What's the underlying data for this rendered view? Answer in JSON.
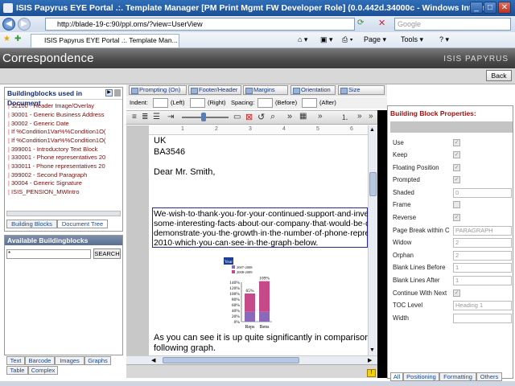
{
  "browser": {
    "title": "ISIS Papyrus EYE Portal .:. Template Manager [PM Print Mgmt FW Developer Role] (0.0.442d.34000c - Windows Interne...",
    "url": "http://blade-19-c:90/ppl.oms/?view=UserView",
    "search_placeholder": "Google",
    "tab_label": "ISIS Papyrus EYE Portal .:. Template Man...",
    "tools": {
      "page": "Page ▾",
      "tools": "Tools ▾"
    }
  },
  "app": {
    "title": "Correspondence",
    "brand": "ISIS PAPYRUS",
    "back_label": "Back"
  },
  "left_panel": {
    "title": "Buildingblocks used in Document",
    "items": [
      "32100 - Header Image/Overlay",
      "30001 - Generic Business Address",
      "30002 - Generic Date",
      "If %Condition1Var%%Condition1O(",
      "If %Condition1Var%%Condition1O(",
      "399001 - Introductory Text Block",
      "330001 - Phone representatives 20",
      "330011 - Phone representatives 20",
      "399002 - Second Paragraph",
      "30004 - Generic Signature",
      "ISIS_PENSION_MWIntro"
    ],
    "tabs": [
      "Building Blocks",
      "Document Tree"
    ]
  },
  "avail_panel": {
    "title": "Available Buildingblocks",
    "search_value": "*",
    "search_button": "SEARCH",
    "tabs_row1": [
      "Text",
      "Barcode",
      "Images",
      "Graphs"
    ],
    "tabs_row2": [
      "Table",
      "Complex"
    ]
  },
  "toolbar": {
    "buttons": [
      "Prompting (On)",
      "Footer/Header",
      "Margins",
      "Orientation",
      "Size"
    ],
    "indent_label": "Indent:",
    "left_label": "(Left)",
    "right_label": "(Right)",
    "spacing_label": "Spacing:",
    "before_label": "(Before)",
    "after_label": "(After)"
  },
  "ruler": {
    "marks": [
      "1",
      "2",
      "3",
      "4",
      "5",
      "6"
    ]
  },
  "document": {
    "lines": [
      "UK",
      "BA3546",
      "Dear Mr. Smith,"
    ],
    "selected_lines": [
      "We·wish·to·thank·you·for·your·continued·support·and·inve",
      "some·interesting·facts·about·our·company·that·would·be·c",
      "demonstrate·you·the·growth·in·the·number·of·phone·repre",
      "2010·which·you·can·see·in·the·graph·below."
    ],
    "after_lines": [
      "As you can see it is up quite significantly in comparison to",
      "following graph."
    ]
  },
  "chart_data": {
    "type": "bar",
    "title": "Year",
    "categories": [
      "Reps",
      "Bens"
    ],
    "series": [
      {
        "name": "2007-2008",
        "values": [
          35,
          35
        ]
      },
      {
        "name": "2008-2009",
        "values": [
          65,
          109
        ]
      }
    ],
    "data_labels": [
      "65%",
      "109%"
    ],
    "y_ticks": [
      "140%",
      "120%",
      "100%",
      "80%",
      "60%",
      "40%",
      "20%",
      "0%"
    ],
    "ylim": [
      0,
      140
    ],
    "colors": {
      "2007-2008": "#8a6ab8",
      "2008-2009": "#c64a8a"
    }
  },
  "properties": {
    "title": "Building Block Properties:",
    "rows": [
      {
        "label": "Use",
        "kind": "check",
        "value": "✓"
      },
      {
        "label": "Keep",
        "kind": "check",
        "value": "✓"
      },
      {
        "label": "Floating Position",
        "kind": "check",
        "value": "✓"
      },
      {
        "label": "Prompted",
        "kind": "check",
        "value": "✓"
      },
      {
        "label": "Shaded",
        "kind": "input",
        "value": "0"
      },
      {
        "label": "Frame",
        "kind": "check",
        "value": ""
      },
      {
        "label": "Reverse",
        "kind": "check",
        "value": "✓"
      },
      {
        "label": "Page Break within C",
        "kind": "input",
        "value": "PARAGRAPH"
      },
      {
        "label": "Widow",
        "kind": "input",
        "value": "2"
      },
      {
        "label": "Orphan",
        "kind": "input",
        "value": "2"
      },
      {
        "label": "Blank Lines Before",
        "kind": "input",
        "value": "1"
      },
      {
        "label": "Blank Lines After",
        "kind": "input",
        "value": "1"
      },
      {
        "label": "Continue With Next",
        "kind": "check",
        "value": "✓"
      },
      {
        "label": "TOC Level",
        "kind": "input",
        "value": "Heading 1"
      },
      {
        "label": "Width",
        "kind": "input",
        "value": ""
      }
    ],
    "tabs": [
      "All",
      "Positioning",
      "Formatting",
      "Others"
    ]
  }
}
